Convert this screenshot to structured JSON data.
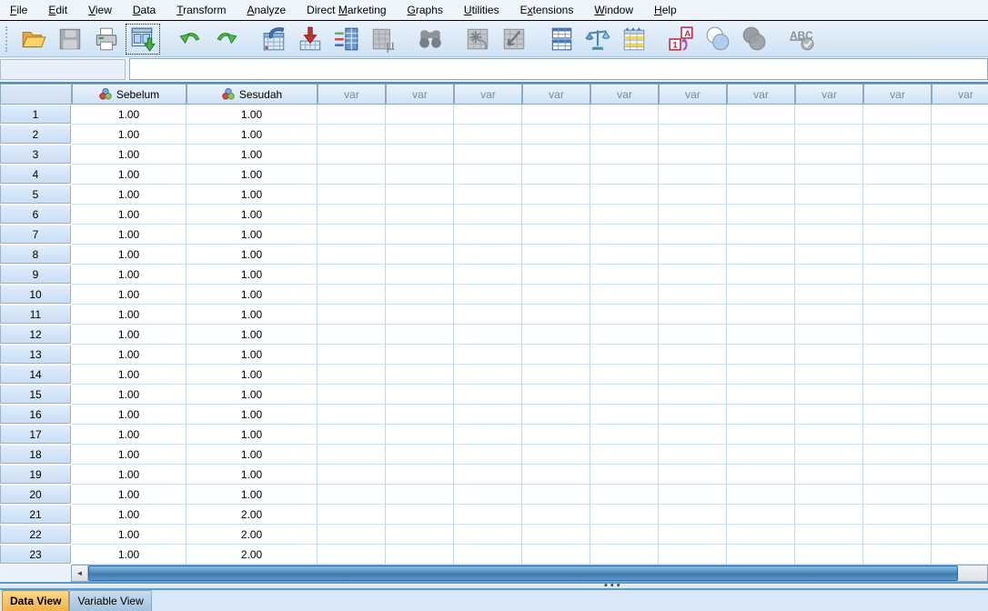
{
  "menubar": {
    "items": [
      {
        "label": "File",
        "underline": 0
      },
      {
        "label": "Edit",
        "underline": 0
      },
      {
        "label": "View",
        "underline": 0
      },
      {
        "label": "Data",
        "underline": 0
      },
      {
        "label": "Transform",
        "underline": 0
      },
      {
        "label": "Analyze",
        "underline": 0
      },
      {
        "label": "Direct Marketing",
        "underline": 7
      },
      {
        "label": "Graphs",
        "underline": 0
      },
      {
        "label": "Utilities",
        "underline": 0
      },
      {
        "label": "Extensions",
        "underline": 1
      },
      {
        "label": "Window",
        "underline": 0
      },
      {
        "label": "Help",
        "underline": 0
      }
    ]
  },
  "toolbar": {
    "buttons": [
      {
        "name": "open-data-document",
        "icon": "open-folder-icon",
        "enabled": true
      },
      {
        "name": "save-document",
        "icon": "save-icon",
        "enabled": false
      },
      {
        "name": "print",
        "icon": "print-icon",
        "enabled": true
      },
      {
        "name": "recall-recently-used-dialogs",
        "icon": "recall-dialogs-icon",
        "enabled": true,
        "focused": true
      },
      {
        "name": "undo",
        "icon": "undo-icon",
        "enabled": true,
        "gap_before": true
      },
      {
        "name": "redo",
        "icon": "redo-icon",
        "enabled": true
      },
      {
        "name": "go-to-case",
        "icon": "go-to-case-icon",
        "enabled": true,
        "gap_before": true
      },
      {
        "name": "go-to-variable",
        "icon": "go-to-variable-icon",
        "enabled": true
      },
      {
        "name": "variables",
        "icon": "variables-icon",
        "enabled": true
      },
      {
        "name": "run-descriptive-statistics",
        "icon": "descriptives-icon",
        "enabled": false
      },
      {
        "name": "find",
        "icon": "find-icon",
        "enabled": false,
        "gap_before": true
      },
      {
        "name": "insert-cases",
        "icon": "insert-cases-icon",
        "enabled": false,
        "gap_before": true
      },
      {
        "name": "insert-variable",
        "icon": "insert-variable-icon",
        "enabled": false
      },
      {
        "name": "split-file",
        "icon": "split-file-icon",
        "enabled": true,
        "gap_before": true
      },
      {
        "name": "weight-cases",
        "icon": "weight-cases-icon",
        "enabled": true
      },
      {
        "name": "select-cases",
        "icon": "select-cases-icon",
        "enabled": true
      },
      {
        "name": "value-labels",
        "icon": "value-labels-icon",
        "enabled": true,
        "gap_before": true
      },
      {
        "name": "use-variable-sets",
        "icon": "use-variable-sets-icon",
        "enabled": true
      },
      {
        "name": "show-all-variables",
        "icon": "show-all-variables-icon",
        "enabled": false
      },
      {
        "name": "spell-check",
        "icon": "spell-check-icon",
        "enabled": false,
        "gap_before": true
      }
    ]
  },
  "cell_editor": {
    "reference": "",
    "value": ""
  },
  "grid": {
    "corner_label": "",
    "columns": [
      {
        "label": "Sebelum",
        "type": "nominal"
      },
      {
        "label": "Sesudah",
        "type": "nominal"
      },
      {
        "label": "var",
        "type": "empty"
      },
      {
        "label": "var",
        "type": "empty"
      },
      {
        "label": "var",
        "type": "empty"
      },
      {
        "label": "var",
        "type": "empty"
      },
      {
        "label": "var",
        "type": "empty"
      },
      {
        "label": "var",
        "type": "empty"
      },
      {
        "label": "var",
        "type": "empty"
      },
      {
        "label": "var",
        "type": "empty"
      },
      {
        "label": "var",
        "type": "empty"
      },
      {
        "label": "var",
        "type": "empty"
      }
    ],
    "rows": [
      {
        "n": "1",
        "cells": [
          "1.00",
          "1.00"
        ]
      },
      {
        "n": "2",
        "cells": [
          "1.00",
          "1.00"
        ]
      },
      {
        "n": "3",
        "cells": [
          "1.00",
          "1.00"
        ]
      },
      {
        "n": "4",
        "cells": [
          "1.00",
          "1.00"
        ]
      },
      {
        "n": "5",
        "cells": [
          "1.00",
          "1.00"
        ]
      },
      {
        "n": "6",
        "cells": [
          "1.00",
          "1.00"
        ]
      },
      {
        "n": "7",
        "cells": [
          "1.00",
          "1.00"
        ]
      },
      {
        "n": "8",
        "cells": [
          "1.00",
          "1.00"
        ]
      },
      {
        "n": "9",
        "cells": [
          "1.00",
          "1.00"
        ]
      },
      {
        "n": "10",
        "cells": [
          "1.00",
          "1.00"
        ]
      },
      {
        "n": "11",
        "cells": [
          "1.00",
          "1.00"
        ]
      },
      {
        "n": "12",
        "cells": [
          "1.00",
          "1.00"
        ]
      },
      {
        "n": "13",
        "cells": [
          "1.00",
          "1.00"
        ]
      },
      {
        "n": "14",
        "cells": [
          "1.00",
          "1.00"
        ]
      },
      {
        "n": "15",
        "cells": [
          "1.00",
          "1.00"
        ]
      },
      {
        "n": "16",
        "cells": [
          "1.00",
          "1.00"
        ]
      },
      {
        "n": "17",
        "cells": [
          "1.00",
          "1.00"
        ]
      },
      {
        "n": "18",
        "cells": [
          "1.00",
          "1.00"
        ]
      },
      {
        "n": "19",
        "cells": [
          "1.00",
          "1.00"
        ]
      },
      {
        "n": "20",
        "cells": [
          "1.00",
          "1.00"
        ]
      },
      {
        "n": "21",
        "cells": [
          "1.00",
          "2.00"
        ]
      },
      {
        "n": "22",
        "cells": [
          "1.00",
          "2.00"
        ]
      },
      {
        "n": "23",
        "cells": [
          "1.00",
          "2.00"
        ]
      }
    ]
  },
  "scrollbar": {
    "left_arrow": "◄"
  },
  "splitter_dots": "•••",
  "tabs": {
    "data_view": "Data View",
    "variable_view": "Variable View",
    "active": "Data View"
  },
  "colors": {
    "active_tab": "#f2b248",
    "inactive_tab": "#a5c3df",
    "scrollbar_thumb": "#4e8cc0",
    "header_bg": "#d0e2f4",
    "var_label_text": "#7b8aa0",
    "nominal_icon": [
      "#7ba7e8",
      "#d84848",
      "#8cc860"
    ]
  }
}
